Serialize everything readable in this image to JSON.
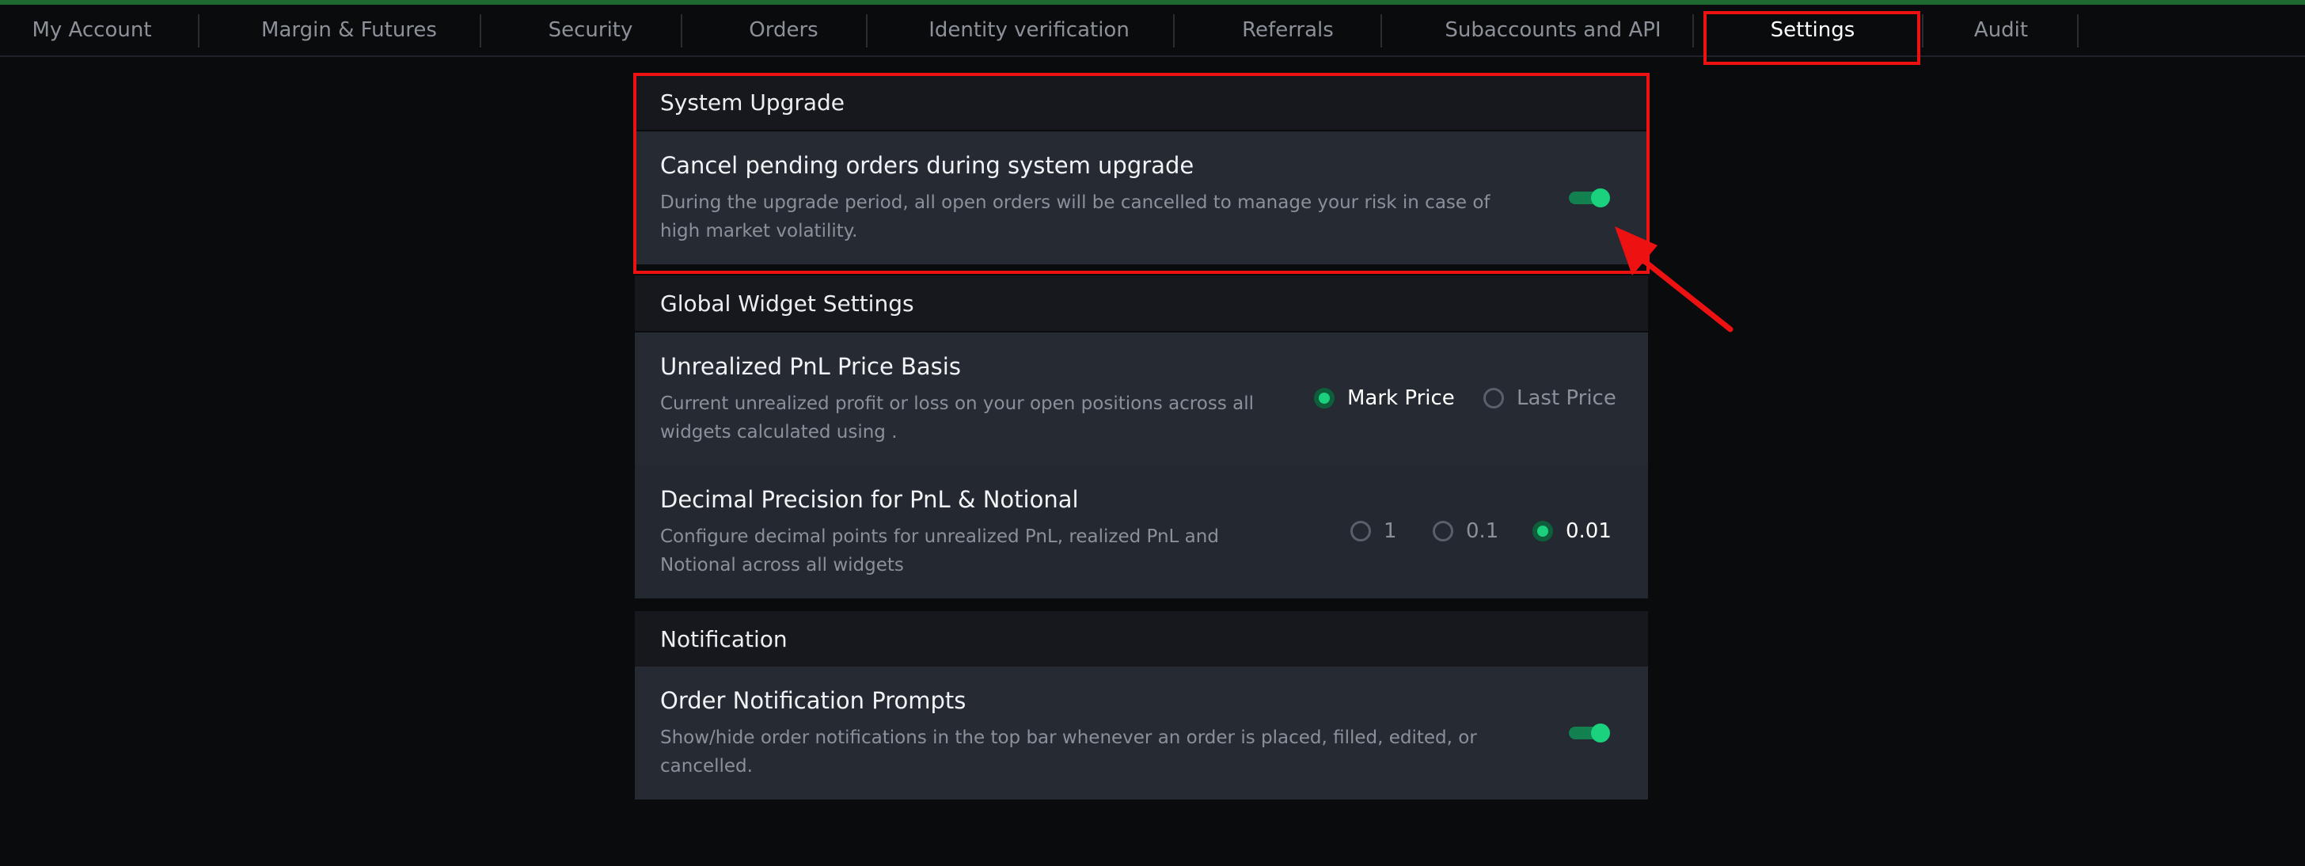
{
  "tabs": [
    {
      "label": "My Account",
      "active": false
    },
    {
      "label": "Margin & Futures",
      "active": false
    },
    {
      "label": "Security",
      "active": false
    },
    {
      "label": "Orders",
      "active": false
    },
    {
      "label": "Identity verification",
      "active": false
    },
    {
      "label": "Referrals",
      "active": false
    },
    {
      "label": "Subaccounts and API",
      "active": false
    },
    {
      "label": "Settings",
      "active": true
    },
    {
      "label": "Audit",
      "active": false
    }
  ],
  "sections": {
    "system_upgrade": {
      "title": "System Upgrade",
      "cancel_orders": {
        "title": "Cancel pending orders during system upgrade",
        "description": "During the upgrade period, all open orders will be cancelled to manage your risk in case of high market volatility.",
        "enabled": true
      }
    },
    "global_widget": {
      "title": "Global Widget Settings",
      "pnl_basis": {
        "title": "Unrealized PnL Price Basis",
        "description": "Current unrealized profit or loss on your open positions across all widgets calculated using .",
        "options": [
          "Mark Price",
          "Last Price"
        ],
        "selected": "Mark Price"
      },
      "decimal_precision": {
        "title": "Decimal Precision for PnL & Notional",
        "description": "Configure decimal points for unrealized PnL, realized PnL and Notional across all widgets",
        "options": [
          "1",
          "0.1",
          "0.01"
        ],
        "selected": "0.01"
      }
    },
    "notification": {
      "title": "Notification",
      "order_prompts": {
        "title": "Order Notification Prompts",
        "description": "Show/hide order notifications in the top bar whenever an order is placed, filled, edited, or cancelled.",
        "enabled": true
      }
    }
  },
  "colors": {
    "background": "#0a0b0d",
    "accent_green": "#1bd17d",
    "highlight_red": "#ee1111"
  }
}
